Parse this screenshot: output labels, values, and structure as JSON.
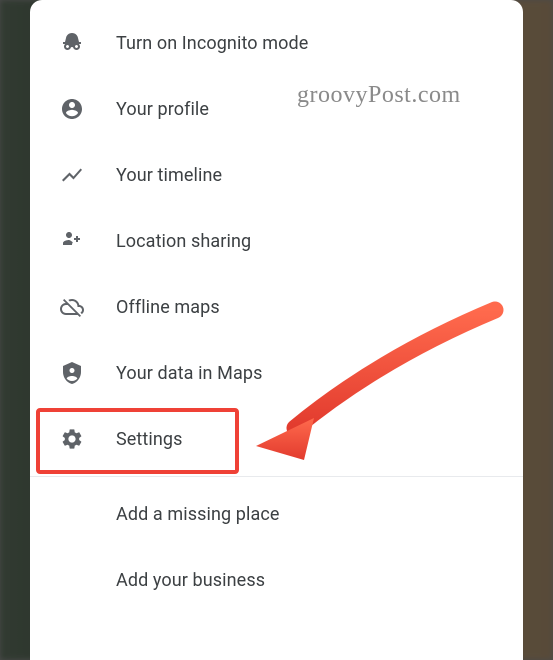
{
  "menu": {
    "items": [
      {
        "label": "Turn on Incognito mode"
      },
      {
        "label": "Your profile"
      },
      {
        "label": "Your timeline"
      },
      {
        "label": "Location sharing"
      },
      {
        "label": "Offline maps"
      },
      {
        "label": "Your data in Maps"
      },
      {
        "label": "Settings"
      }
    ],
    "secondary": [
      {
        "label": "Add a missing place"
      },
      {
        "label": "Add your business"
      }
    ]
  },
  "watermark": {
    "text": "groovyPost.com"
  },
  "annotation": {
    "highlight_target": "Settings",
    "color": "#ef4136"
  }
}
